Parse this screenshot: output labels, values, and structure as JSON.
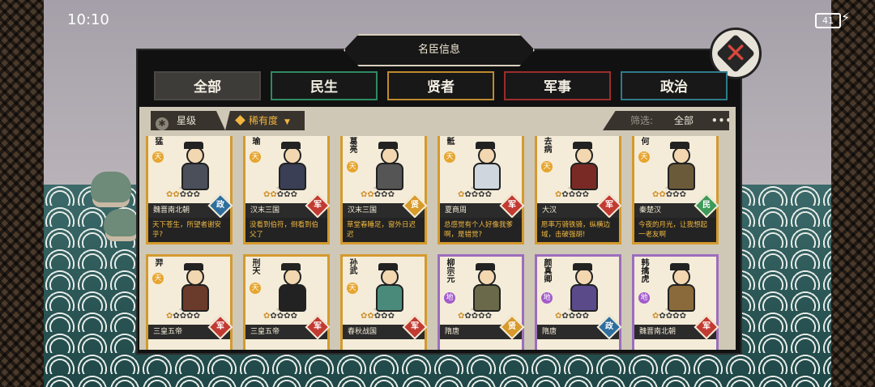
{
  "status": {
    "time": "10:10",
    "battery": "41"
  },
  "title": "名臣信息",
  "tabs": [
    "全部",
    "民生",
    "贤者",
    "军事",
    "政治"
  ],
  "filters": {
    "star_label": "星级",
    "rarity_label": "稀有度",
    "screen_label": "筛选:",
    "screen_value": "全部",
    "more": "•••"
  },
  "colors": {
    "tian": "#e6a52e",
    "di": "#a25bcb",
    "zheng": "#2e6f9e",
    "jun": "#c23b32",
    "xian": "#d89a2a",
    "min": "#3e9a5a"
  },
  "cards": [
    {
      "name": "猛",
      "rank": "天",
      "stars": 2,
      "era": "魏晋南北朝",
      "cat": "政",
      "quote": "天下苍生，所望者谢安乎?"
    },
    {
      "name": "瑜",
      "rank": "天",
      "stars": 2,
      "era": "汉末三国",
      "cat": "军",
      "quote": "没看到伯符，倒看到伯父了"
    },
    {
      "name": "葛亮",
      "rank": "天",
      "stars": 2,
      "era": "汉末三国",
      "cat": "贤",
      "quote": "草堂春睡足，窗外日迟迟"
    },
    {
      "name": "骶",
      "rank": "天",
      "stars": 1,
      "era": "夏商周",
      "cat": "军",
      "quote": "总感觉有个人好像我爹啊，是错觉?"
    },
    {
      "name": "去病",
      "rank": "天",
      "stars": 1,
      "era": "大汉",
      "cat": "军",
      "quote": "愿率万骑铁骑，纵横边域，击破强胡!"
    },
    {
      "name": "何",
      "rank": "天",
      "stars": 2,
      "era": "秦楚汉",
      "cat": "民",
      "quote": "今夜的月光，让我想起一老友啊"
    },
    {
      "name": "羿",
      "rank": "天",
      "stars": 1,
      "era": "三皇五帝",
      "cat": "军",
      "quote": ""
    },
    {
      "name": "刑天",
      "rank": "天",
      "stars": 1,
      "era": "三皇五帝",
      "cat": "军",
      "quote": ""
    },
    {
      "name": "孙武",
      "rank": "天",
      "stars": 2,
      "era": "春秋战国",
      "cat": "军",
      "quote": ""
    },
    {
      "name": "柳宗元",
      "rank": "地",
      "stars": 1,
      "era": "隋唐",
      "cat": "贤",
      "quote": ""
    },
    {
      "name": "颜真卿",
      "rank": "地",
      "stars": 1,
      "era": "隋唐",
      "cat": "政",
      "quote": ""
    },
    {
      "name": "韩擒虎",
      "rank": "地",
      "stars": 1,
      "era": "魏晋南北朝",
      "cat": "军",
      "quote": ""
    }
  ]
}
